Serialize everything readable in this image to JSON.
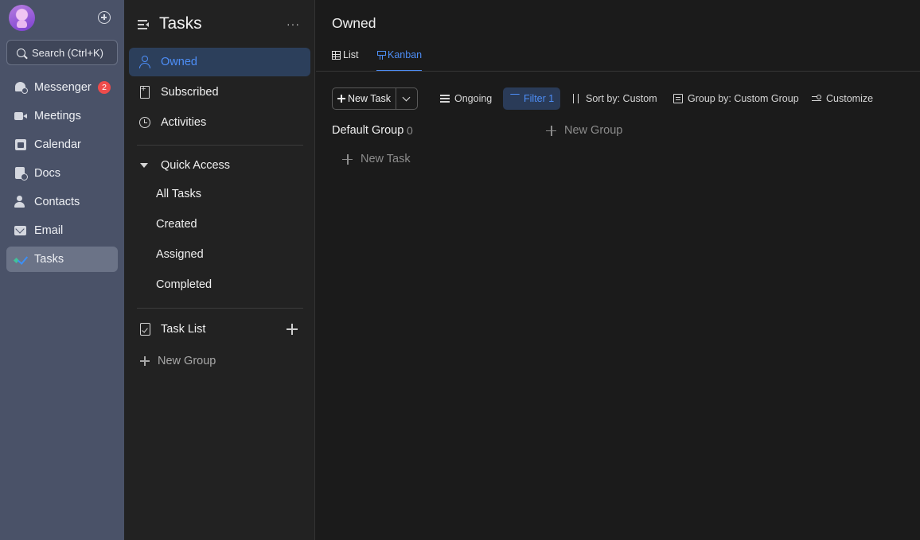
{
  "rail": {
    "search_label": "Search (Ctrl+K)",
    "items": [
      {
        "label": "Messenger",
        "icon": "messenger-icon",
        "badge": "2"
      },
      {
        "label": "Meetings",
        "icon": "video-camera-icon"
      },
      {
        "label": "Calendar",
        "icon": "calendar-icon"
      },
      {
        "label": "Docs",
        "icon": "docs-icon"
      },
      {
        "label": "Contacts",
        "icon": "contacts-icon"
      },
      {
        "label": "Email",
        "icon": "email-icon"
      },
      {
        "label": "Tasks",
        "icon": "tasks-icon",
        "active": true
      }
    ]
  },
  "sidebar": {
    "title": "Tasks",
    "items": [
      {
        "label": "Owned",
        "icon": "person-icon",
        "active": true
      },
      {
        "label": "Subscribed",
        "icon": "bookmark-icon"
      },
      {
        "label": "Activities",
        "icon": "history-icon"
      }
    ],
    "quick_access": {
      "label": "Quick Access",
      "items": [
        "All Tasks",
        "Created",
        "Assigned",
        "Completed"
      ]
    },
    "task_list_label": "Task List",
    "new_group_label": "New Group"
  },
  "main": {
    "title": "Owned",
    "tabs": [
      {
        "label": "List",
        "icon": "table-icon"
      },
      {
        "label": "Kanban",
        "icon": "kanban-icon",
        "active": true
      }
    ],
    "toolbar": {
      "new_task_label": "New Task",
      "ongoing_label": "Ongoing",
      "filter_label": "Filter 1",
      "sort_label": "Sort by: Custom",
      "group_label": "Group by: Custom Group",
      "customize_label": "Customize"
    },
    "board": {
      "group_name": "Default Group",
      "group_count": "0",
      "new_task_label": "New Task",
      "new_group_label": "New Group"
    }
  },
  "colors": {
    "accent": "#4d8ef7",
    "rail_bg": "#4a5268",
    "sidebar_bg": "#222222",
    "main_bg": "#1b1b1b",
    "badge": "#ee4c4c"
  }
}
